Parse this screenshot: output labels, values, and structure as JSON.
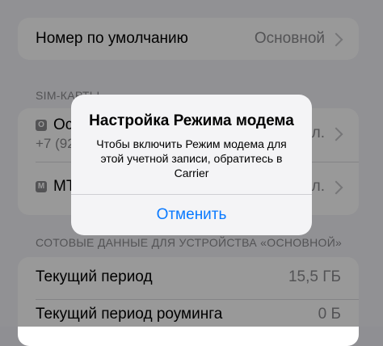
{
  "default_number": {
    "label": "Номер по умолчанию",
    "value": "Основной"
  },
  "sim_section": {
    "header": "SIM-КАРТЫ",
    "items": [
      {
        "badge": "О",
        "name": "Ос",
        "phone": "+7 (92",
        "value_tail": "л."
      },
      {
        "badge": "M",
        "name": "МТ",
        "value_tail": "л."
      }
    ]
  },
  "data_section": {
    "header": "СОТОВЫЕ ДАННЫЕ ДЛЯ УСТРОЙСТВА «ОСНОВНОЙ»",
    "rows": [
      {
        "label": "Текущий период",
        "value": "15,5 ГБ"
      },
      {
        "label": "Текущий период роуминга",
        "value": "0 Б"
      }
    ]
  },
  "alert": {
    "title": "Настройка Режима модема",
    "message": "Чтобы включить Режим модема для этой учетной записи, обратитесь в Carrier",
    "cancel_label": "Отменить"
  }
}
